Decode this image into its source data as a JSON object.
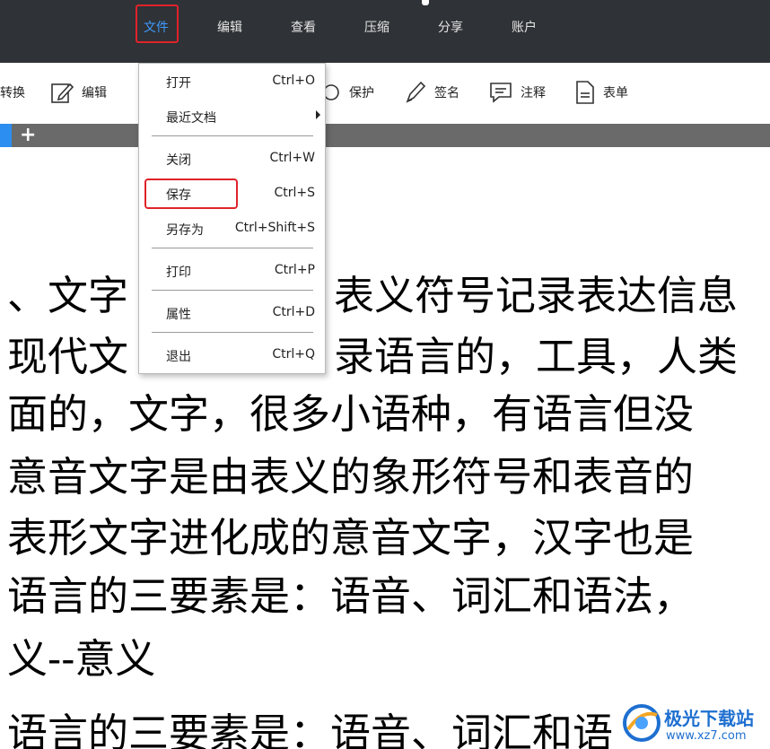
{
  "menubar": {
    "items": [
      "文件",
      "编辑",
      "查看",
      "压缩",
      "分享",
      "账户"
    ]
  },
  "toolbar": {
    "items": [
      "转换",
      "编辑",
      "保护",
      "签名",
      "注释",
      "表单"
    ]
  },
  "tabbar": {
    "add_label": "+"
  },
  "file_menu": {
    "items": [
      {
        "label": "打开",
        "shortcut": "Ctrl+O"
      },
      {
        "label": "最近文档",
        "shortcut": ""
      },
      {
        "label": "关闭",
        "shortcut": "Ctrl+W"
      },
      {
        "label": "保存",
        "shortcut": "Ctrl+S"
      },
      {
        "label": "另存为",
        "shortcut": "Ctrl+Shift+S"
      },
      {
        "label": "打印",
        "shortcut": "Ctrl+P"
      },
      {
        "label": "属性",
        "shortcut": "Ctrl+D"
      },
      {
        "label": "退出",
        "shortcut": "Ctrl+Q"
      }
    ]
  },
  "document": {
    "lines": [
      "、文字",
      "表义符号记录表达信息",
      "现代文",
      "录语言的，工具，人类",
      "面的，文字，很多小语种，有语言但没",
      "意音文字是由表义的象形符号和表音的",
      "表形文字进化成的意音文字，汉字也是",
      "语言的三要素是：语音、词汇和语法，",
      "义--意义",
      "语言的三要素是：语音、词汇和语"
    ]
  },
  "watermark": {
    "name": "极光下载站",
    "url": "www.xz7.com"
  },
  "colors": {
    "menubar_bg": "#2f3236",
    "active_menu": "#3d9bff",
    "highlight": "#e0232a",
    "tab_active": "#2b8ef0"
  }
}
